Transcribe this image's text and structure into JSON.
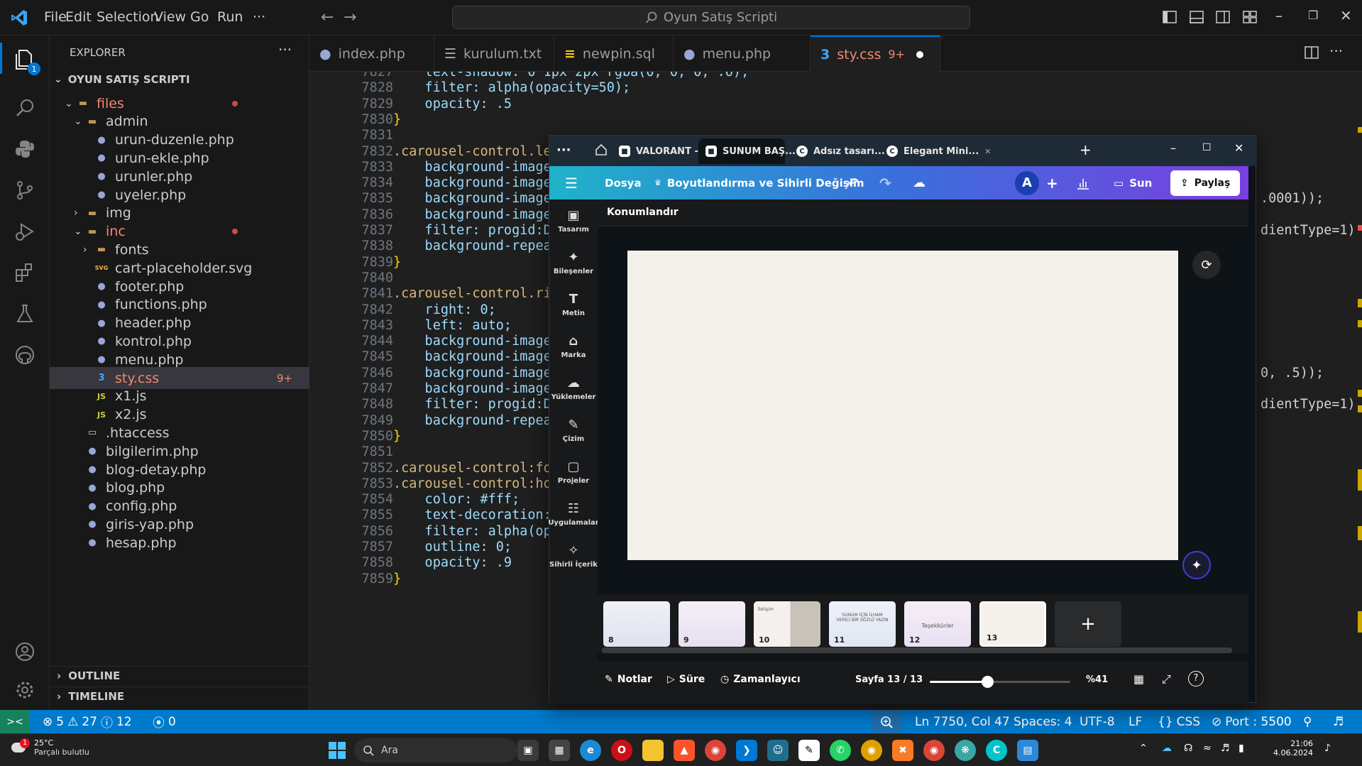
{
  "titlebar": {
    "menu": [
      "File",
      "Edit",
      "Selection",
      "View",
      "Go",
      "Run",
      "···"
    ],
    "search_placeholder": "Oyun Satış Scripti"
  },
  "activity": {
    "explorer_badge": "1"
  },
  "sidebar": {
    "header": "EXPLORER",
    "more": "···",
    "root": "OYUN SATIŞ SCRIPTI",
    "rows": [
      {
        "label": "files",
        "type": "folder-open",
        "depth": 1,
        "dot": true,
        "color": "#f48771"
      },
      {
        "label": "admin",
        "type": "folder-open",
        "depth": 2
      },
      {
        "label": "urun-duzenle.php",
        "type": "php",
        "depth": 3
      },
      {
        "label": "urun-ekle.php",
        "type": "php",
        "depth": 3
      },
      {
        "label": "urunler.php",
        "type": "php",
        "depth": 3
      },
      {
        "label": "uyeler.php",
        "type": "php",
        "depth": 3
      },
      {
        "label": "img",
        "type": "folder",
        "depth": 2
      },
      {
        "label": "inc",
        "type": "folder-open",
        "depth": 2,
        "dot": true,
        "color": "#f48771"
      },
      {
        "label": "fonts",
        "type": "folder",
        "depth": 3
      },
      {
        "label": "cart-placeholder.svg",
        "type": "svg",
        "depth": 3
      },
      {
        "label": "footer.php",
        "type": "php",
        "depth": 3
      },
      {
        "label": "functions.php",
        "type": "php",
        "depth": 3
      },
      {
        "label": "header.php",
        "type": "php",
        "depth": 3
      },
      {
        "label": "kontrol.php",
        "type": "php",
        "depth": 3
      },
      {
        "label": "menu.php",
        "type": "php",
        "depth": 3
      },
      {
        "label": "sty.css",
        "type": "css",
        "depth": 3,
        "badge": "9+",
        "color": "#f48771",
        "selected": true
      },
      {
        "label": "x1.js",
        "type": "js",
        "depth": 3
      },
      {
        "label": "x2.js",
        "type": "js",
        "depth": 3
      },
      {
        "label": ".htaccess",
        "type": "file",
        "depth": 2
      },
      {
        "label": "bilgilerim.php",
        "type": "php",
        "depth": 2
      },
      {
        "label": "blog-detay.php",
        "type": "php",
        "depth": 2
      },
      {
        "label": "blog.php",
        "type": "php",
        "depth": 2
      },
      {
        "label": "config.php",
        "type": "php",
        "depth": 2
      },
      {
        "label": "giris-yap.php",
        "type": "php",
        "depth": 2
      },
      {
        "label": "hesap.php",
        "type": "php",
        "depth": 2
      }
    ],
    "outline": "OUTLINE",
    "timeline": "TIMELINE"
  },
  "tabs": [
    {
      "label": "index.php",
      "icon": "php"
    },
    {
      "label": "kurulum.txt",
      "icon": "txt"
    },
    {
      "label": "newpin.sql",
      "icon": "sql"
    },
    {
      "label": "menu.php",
      "icon": "php"
    },
    {
      "label": "sty.css",
      "icon": "css",
      "badge": "9+",
      "active": true
    }
  ],
  "editor": {
    "lines": [
      {
        "n": "7827",
        "t": "    text-shadow: 0 1px 2px rgba(0, 0, 0, .6);"
      },
      {
        "n": "7828",
        "t": "    filter: alpha(opacity=50);"
      },
      {
        "n": "7829",
        "t": "    opacity: .5"
      },
      {
        "n": "7830",
        "t": "}"
      },
      {
        "n": "7831",
        "t": ""
      },
      {
        "n": "7832",
        "t": ".carousel-control.le"
      },
      {
        "n": "7833",
        "t": "    background-image"
      },
      {
        "n": "7834",
        "t": "    background-image"
      },
      {
        "n": "7835",
        "t": "    background-image"
      },
      {
        "n": "7836",
        "t": "    background-image"
      },
      {
        "n": "7837",
        "t": "    filter: progid:D"
      },
      {
        "n": "7838",
        "t": "    background-repea"
      },
      {
        "n": "7839",
        "t": "}"
      },
      {
        "n": "7840",
        "t": ""
      },
      {
        "n": "7841",
        "t": ".carousel-control.ri"
      },
      {
        "n": "7842",
        "t": "    right: 0;"
      },
      {
        "n": "7843",
        "t": "    left: auto;"
      },
      {
        "n": "7844",
        "t": "    background-image"
      },
      {
        "n": "7845",
        "t": "    background-image"
      },
      {
        "n": "7846",
        "t": "    background-image"
      },
      {
        "n": "7847",
        "t": "    background-image"
      },
      {
        "n": "7848",
        "t": "    filter: progid:D"
      },
      {
        "n": "7849",
        "t": "    background-repea"
      },
      {
        "n": "7850",
        "t": "}"
      },
      {
        "n": "7851",
        "t": ""
      },
      {
        "n": "7852",
        "t": ".carousel-control:fo"
      },
      {
        "n": "7853",
        "t": ".carousel-control:ho"
      },
      {
        "n": "7854",
        "t": "    color: #fff;"
      },
      {
        "n": "7855",
        "t": "    text-decoration:"
      },
      {
        "n": "7856",
        "t": "    filter: alpha(op"
      },
      {
        "n": "7857",
        "t": "    outline: 0;"
      },
      {
        "n": "7858",
        "t": "    opacity: .9"
      },
      {
        "n": "7859",
        "t": "}"
      }
    ],
    "right_fragments": [
      {
        "line": "7835",
        "t": ".0001));"
      },
      {
        "line": "7837",
        "t": "dientType=1);"
      },
      {
        "line": "7846",
        "t": "0, .5));"
      },
      {
        "line": "7848",
        "t": "dientType=1);"
      }
    ]
  },
  "status": {
    "remote": "><",
    "errors": "5",
    "warnings": "27",
    "infos": "12",
    "ports": "0",
    "position": "Ln 7750, Col 47",
    "spaces": "Spaces: 4",
    "encoding": "UTF-8",
    "eol": "LF",
    "language": "CSS",
    "port": "Port : 5500"
  },
  "canva": {
    "tabs": [
      {
        "label": "VALORANT -...",
        "icon": "canva-sq"
      },
      {
        "label": "SUNUM BAŞ...",
        "icon": "canva-sq",
        "active": true
      },
      {
        "label": "Adsız tasarı...",
        "icon": "canva-c"
      },
      {
        "label": "Elegant Mini...",
        "icon": "canva-c"
      }
    ],
    "toolbar": {
      "file": "Dosya",
      "resize": "Boyutlandırma ve Sihirli Değişim",
      "avatar": "A",
      "present": "Sun",
      "share": "Paylaş"
    },
    "side_items": [
      "Tasarım",
      "Bileşenler",
      "Metin",
      "Marka",
      "Yüklemeler",
      "Çizim",
      "Projeler",
      "Uygulamalar",
      "Sihirli İçerik"
    ],
    "context_label": "Konumlandır",
    "canvas_color": "#f4f0ea",
    "thumbnails": [
      {
        "num": "8",
        "text": ""
      },
      {
        "num": "9",
        "text": ""
      },
      {
        "num": "10",
        "text": "İletişim"
      },
      {
        "num": "11",
        "text": "SUNUM İÇİN İLHAM VERİCİ BİR SÖZLÜ YAZIN"
      },
      {
        "num": "12",
        "text": "Teşekkürler"
      },
      {
        "num": "13",
        "text": ""
      }
    ],
    "bottom": {
      "notes": "Notlar",
      "duration": "Süre",
      "timer": "Zamanlayıcı",
      "page": "Sayfa 13 / 13",
      "zoom": "%41",
      "zoom_level": 0.41
    }
  },
  "taskbar": {
    "weather_temp": "25°C",
    "weather_desc": "Parçalı bulutlu",
    "weather_badge": "1",
    "search": "Ara",
    "time": "21:06",
    "date": "4.06.2024"
  }
}
